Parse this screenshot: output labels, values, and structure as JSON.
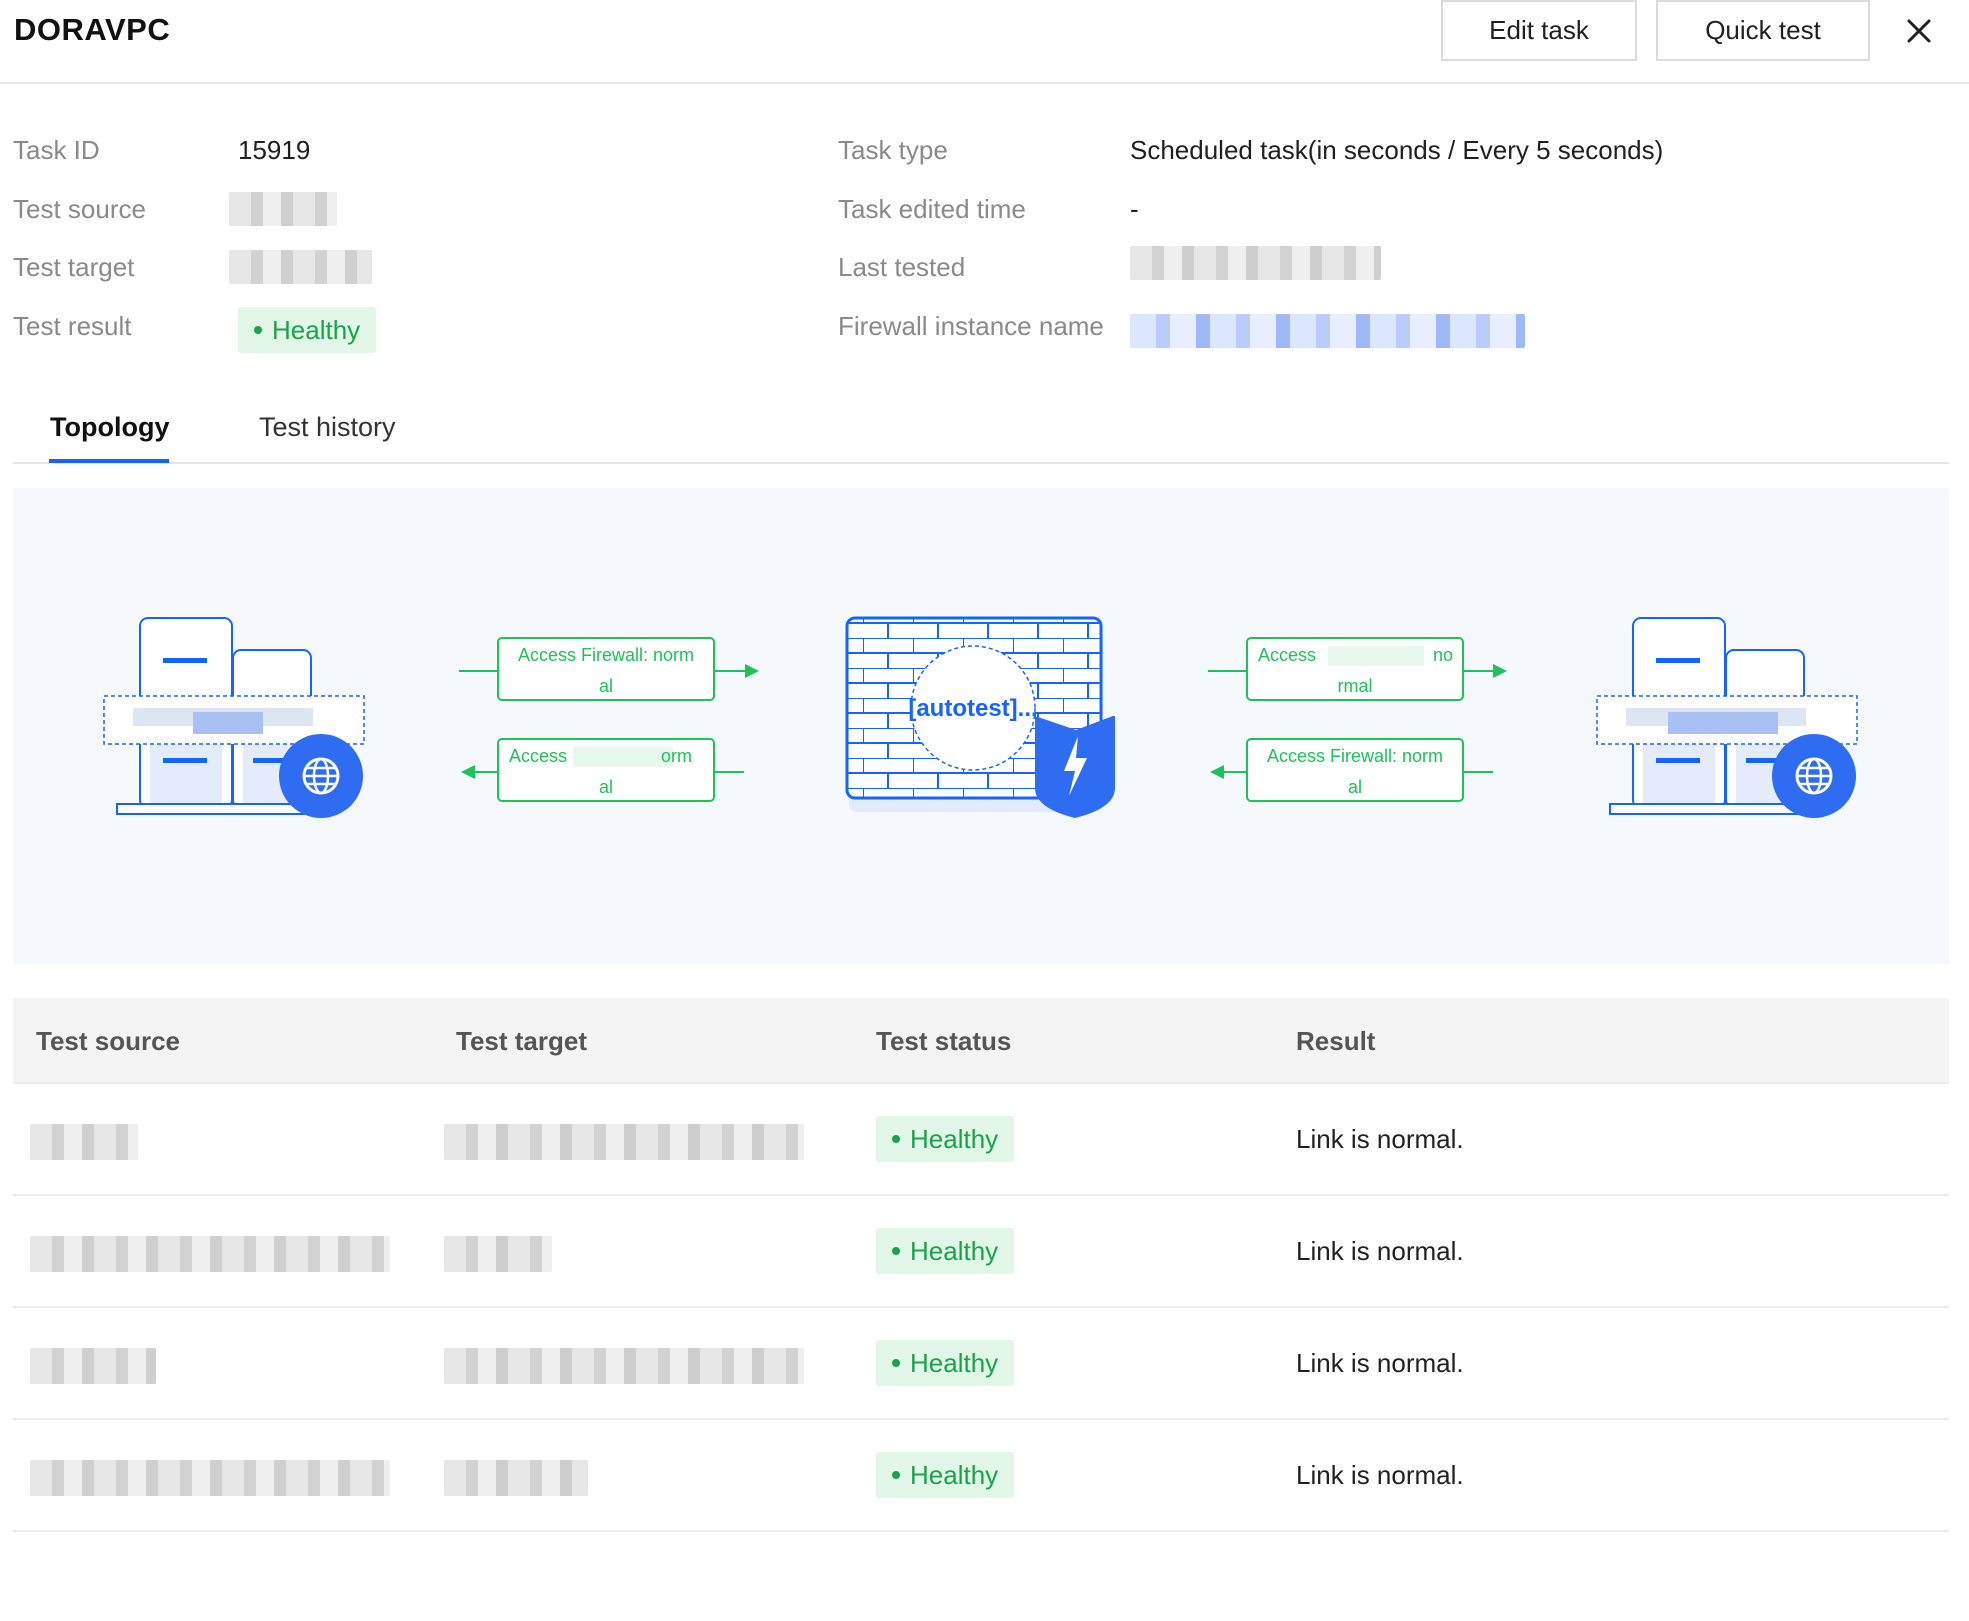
{
  "header": {
    "title": "DORAVPC",
    "edit_task_label": "Edit task",
    "quick_test_label": "Quick test",
    "close_icon": "close-icon"
  },
  "info": {
    "task_id_label": "Task ID",
    "task_id_value": "15919",
    "test_source_label": "Test source",
    "test_target_label": "Test target",
    "test_result_label": "Test result",
    "test_result_value": "Healthy",
    "task_type_label": "Task type",
    "task_type_value": "Scheduled task(in seconds / Every 5 seconds)",
    "task_edited_time_label": "Task edited time",
    "task_edited_time_value": "-",
    "last_tested_label": "Last tested",
    "firewall_instance_label": "Firewall instance name"
  },
  "tabs": [
    {
      "label": "Topology",
      "active": true
    },
    {
      "label": "Test history",
      "active": false
    }
  ],
  "topology": {
    "link_top_left_l1": "Access Firewall: norm",
    "link_top_left_l2": "al",
    "link_bottom_left_l1": "Access",
    "link_bottom_left_l1b": "orm",
    "link_bottom_left_l2": "al",
    "firewall_label": "[autotest]...",
    "link_top_right_l1": "Access",
    "link_top_right_l1b": "no",
    "link_top_right_l2": "rmal",
    "link_bottom_right_l1": "Access Firewall: norm",
    "link_bottom_right_l2": "al",
    "colors": {
      "green": "#1ec25a",
      "blue": "#1664ff",
      "panel": "#f5f8fd"
    }
  },
  "table": {
    "headers": [
      "Test source",
      "Test target",
      "Test status",
      "Result"
    ],
    "rows": [
      {
        "status": "Healthy",
        "result": "Link is normal."
      },
      {
        "status": "Healthy",
        "result": "Link is normal."
      },
      {
        "status": "Healthy",
        "result": "Link is normal."
      },
      {
        "status": "Healthy",
        "result": "Link is normal."
      }
    ]
  }
}
